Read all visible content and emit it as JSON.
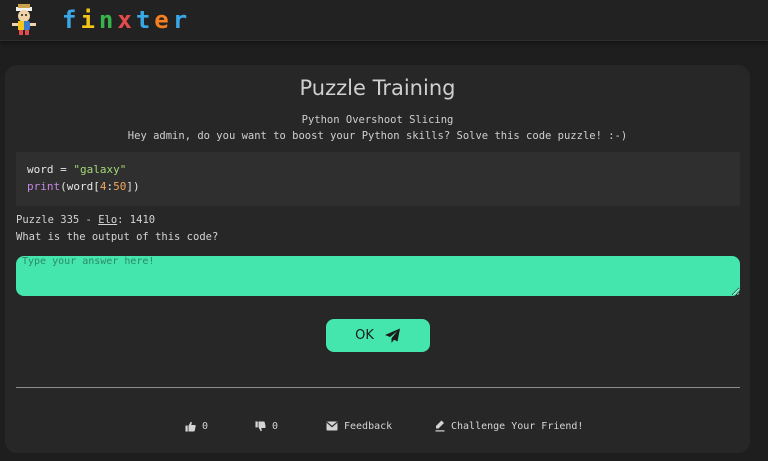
{
  "header": {
    "logo_text": "finxter",
    "logo_colors": [
      "#3aa8e6",
      "#f5c518",
      "#38b54a",
      "#e54b4b",
      "#3aa8e6",
      "#f57f20",
      "#3aa8e6"
    ]
  },
  "puzzle": {
    "title": "Puzzle Training",
    "subtitle": "Python Overshoot Slicing",
    "greeting": "Hey admin, do you want to boost your Python skills? Solve this code puzzle! :-)",
    "code": {
      "line1": {
        "var": "word",
        "op": " = ",
        "str": "\"galaxy\""
      },
      "line2": {
        "fn": "print",
        "open": "(word[",
        "start": "4",
        "colon": ":",
        "end": "50",
        "close": "])"
      }
    },
    "info_prefix": "Puzzle 335 - ",
    "elo_label": "Elo",
    "elo_value": ": 1410",
    "question": "What is the output of this code?",
    "answer_placeholder": "Type your answer here!",
    "ok_label": "OK"
  },
  "footer": {
    "likes": "0",
    "dislikes": "0",
    "feedback_label": "Feedback",
    "challenge_label": "Challenge Your Friend!"
  },
  "colors": {
    "accent": "#45e6ae",
    "background": "#1e1e1e",
    "card": "#272727"
  }
}
